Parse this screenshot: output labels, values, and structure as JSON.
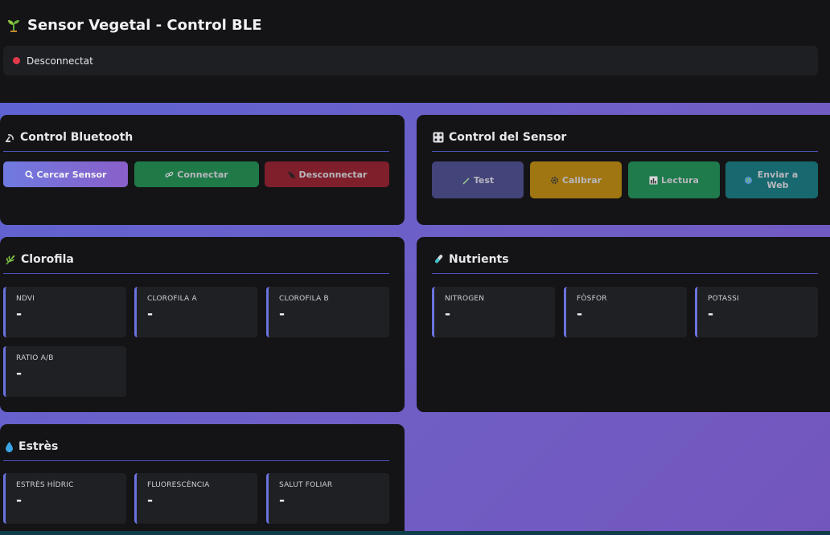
{
  "app": {
    "title": "Sensor Vegetal - Control BLE"
  },
  "status": {
    "text": "Desconnectat",
    "color": "#e23a4a"
  },
  "bluetooth": {
    "title": "Control Bluetooth",
    "buttons": [
      {
        "label": "Cercar Sensor",
        "icon": "magnifier-icon"
      },
      {
        "label": "Connectar",
        "icon": "link-icon"
      },
      {
        "label": "Desconnectar",
        "icon": "plug-icon"
      }
    ]
  },
  "sensor": {
    "title": "Control del Sensor",
    "buttons": [
      {
        "label": "Test",
        "icon": "pencil-icon"
      },
      {
        "label": "Calibrar",
        "icon": "gear-icon"
      },
      {
        "label": "Lectura",
        "icon": "bar-chart-icon"
      },
      {
        "label": "Enviar a Web",
        "icon": "globe-icon"
      }
    ]
  },
  "chlorophyll": {
    "title": "Clorofila",
    "tiles": [
      {
        "label": "NDVI",
        "value": "-"
      },
      {
        "label": "Clorofila A",
        "value": "-"
      },
      {
        "label": "Clorofila B",
        "value": "-"
      },
      {
        "label": "Ratio A/B",
        "value": "-"
      }
    ]
  },
  "nutrients": {
    "title": "Nutrients",
    "tiles": [
      {
        "label": "Nitrogen",
        "value": "-"
      },
      {
        "label": "Fòsfor",
        "value": "-"
      },
      {
        "label": "Potassi",
        "value": "-"
      }
    ]
  },
  "stress": {
    "title": "Estrès",
    "tiles": [
      {
        "label": "Estrès Hídric",
        "value": "-"
      },
      {
        "label": "Fluorescència",
        "value": "-"
      },
      {
        "label": "Salut Foliar",
        "value": "-"
      }
    ]
  },
  "colors": {
    "accent": "#6a72dd",
    "search": "#7a6bd8",
    "connect": "#1f7a48",
    "disconnect": "#7e1f2b",
    "test": "#43447a",
    "calibrate": "#a07612",
    "reading": "#1f7a4c",
    "send": "#18696f"
  }
}
